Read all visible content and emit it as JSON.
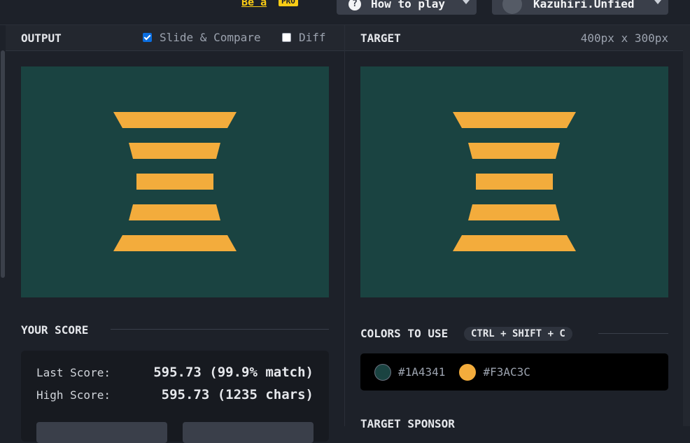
{
  "topbar": {
    "pro_link": "Be a",
    "pro_badge": "PRO",
    "howto_label": "How to play",
    "howto_icon": "question-icon",
    "username": "Kazuhiri.Unfied"
  },
  "output": {
    "title": "OUTPUT",
    "slide_compare_label": "Slide & Compare",
    "slide_compare_checked": true,
    "diff_label": "Diff",
    "diff_checked": false
  },
  "target": {
    "title": "TARGET",
    "dimensions": "400px x 300px"
  },
  "score": {
    "title": "YOUR SCORE",
    "last_label": "Last Score:",
    "last_value": "595.73 (99.9% match)",
    "high_label": "High Score:",
    "high_value": "595.73 (1235 chars)"
  },
  "colors": {
    "title": "COLORS TO USE",
    "shortcut": "CTRL + SHIFT + C",
    "items": [
      {
        "hex": "#1A4341",
        "color": "#1A4341"
      },
      {
        "hex": "#F3AC3C",
        "color": "#F3AC3C"
      }
    ]
  },
  "sponsor": {
    "title": "TARGET SPONSOR"
  },
  "canvas_colors": {
    "background": "#1A4341",
    "shape": "#F3AC3C"
  }
}
